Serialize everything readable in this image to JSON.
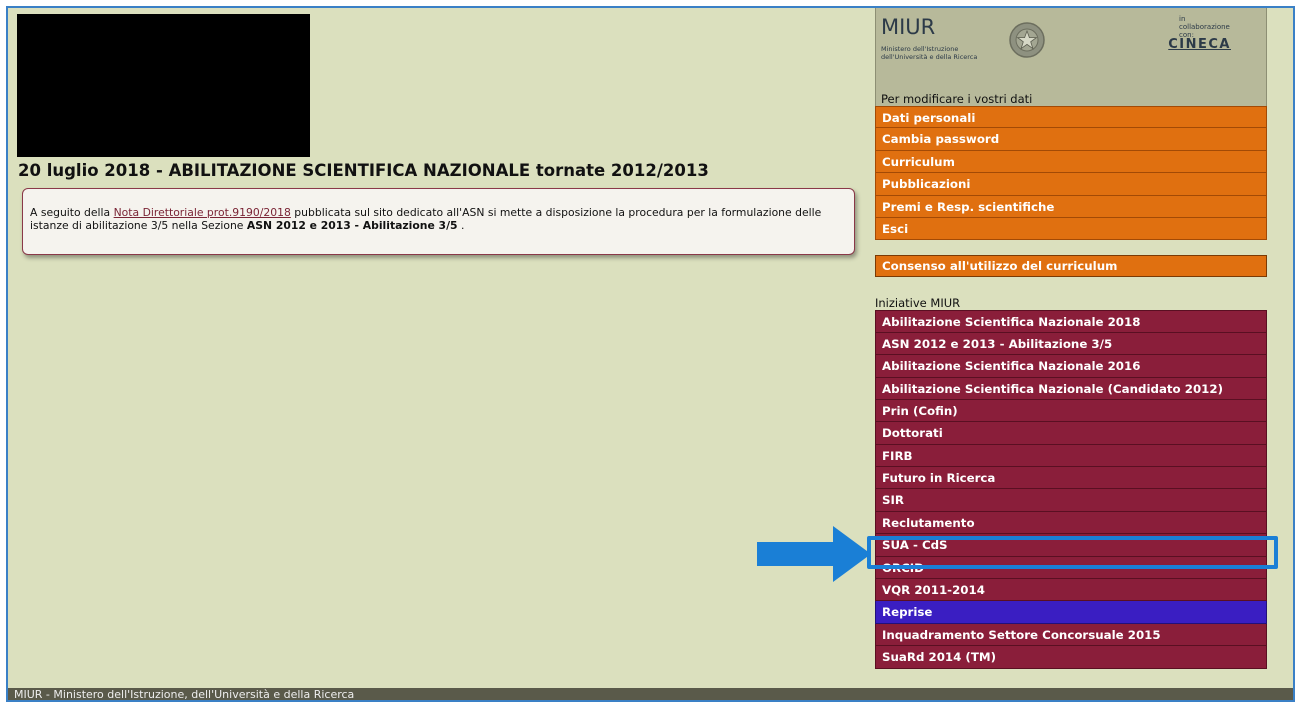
{
  "headline": "20 luglio 2018 - ABILITAZIONE SCIENTIFICA NAZIONALE tornate 2012/2013",
  "notice": {
    "text_before": "A seguito della ",
    "link": "Nota Direttoriale prot.9190/2018",
    "text_middle": " pubblicata sul sito dedicato all'ASN si mette a disposizione la procedura per la formulazione delle istanze di abilitazione 3/5 nella Sezione ",
    "bold": "ASN 2012 e 2013 - Abilitazione 3/5",
    "text_after": " ."
  },
  "miur": {
    "title": "MIUR",
    "subtitle_line1": "Ministero dell'Istruzione",
    "subtitle_line2": "dell'Università e della Ricerca",
    "collab_line1": "in collaborazione",
    "collab_line2": "con:",
    "partner": "CINECA",
    "emblem_icon": "italian-republic-emblem-icon"
  },
  "edit_label": "Per modificare i vostri dati",
  "personal_menu": [
    {
      "label": "Dati personali"
    },
    {
      "label": "Cambia password"
    },
    {
      "label": "Curriculum"
    },
    {
      "label": "Pubblicazioni"
    },
    {
      "label": "Premi e Resp. scientifiche"
    },
    {
      "label": "Esci"
    }
  ],
  "consent_label": "Consenso all'utilizzo del curriculum",
  "initiatives_label": "Iniziative MIUR",
  "initiatives_menu": [
    {
      "label": "Abilitazione Scientifica Nazionale 2018"
    },
    {
      "label": "ASN 2012 e 2013 - Abilitazione 3/5"
    },
    {
      "label": "Abilitazione Scientifica Nazionale 2016"
    },
    {
      "label": "Abilitazione Scientifica Nazionale (Candidato 2012)"
    },
    {
      "label": "Prin (Cofin)"
    },
    {
      "label": "Dottorati"
    },
    {
      "label": "FIRB"
    },
    {
      "label": "Futuro in Ricerca"
    },
    {
      "label": "SIR"
    },
    {
      "label": "Reclutamento"
    },
    {
      "label": "SUA - CdS"
    },
    {
      "label": "ORCID"
    },
    {
      "label": "VQR 2011-2014"
    },
    {
      "label": "Reprise"
    },
    {
      "label": "Inquadramento Settore Concorsuale 2015"
    },
    {
      "label": "SuaRd 2014 (TM)"
    }
  ],
  "footer": "MIUR - Ministero dell'Istruzione, dell'Università e della Ricerca",
  "colors": {
    "page_bg": "#dbe0be",
    "orange_menu": "#e07010",
    "maroon_menu": "#8a1e3a",
    "reprise_menu": "#3a1ec2",
    "highlight": "#1a7fd6"
  },
  "annotation": {
    "arrow_icon": "right-arrow-icon",
    "highlighted_item": "SUA - CdS"
  }
}
